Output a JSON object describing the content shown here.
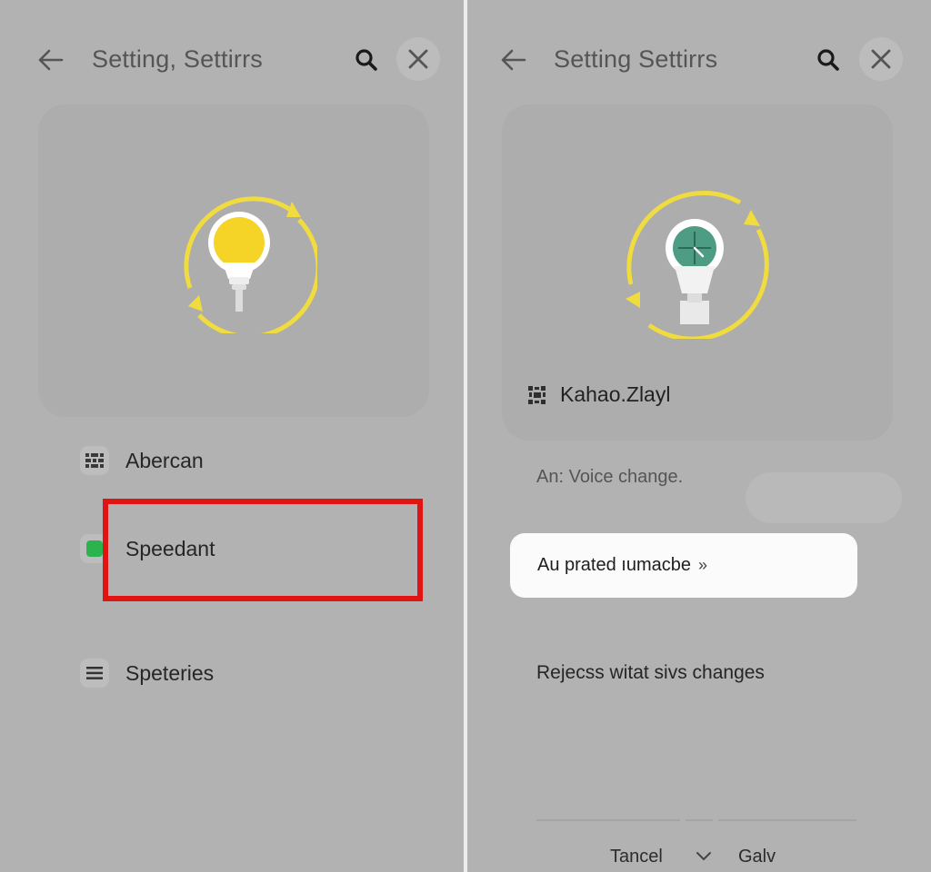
{
  "left_screen": {
    "header": {
      "title": "Setting, Settirrs",
      "back_icon": "arrow-left-icon",
      "search_icon": "search-icon",
      "close_icon": "close-icon"
    },
    "hero": {
      "icon": "lightbulb-refresh-icon",
      "bulb_color": "#f5d327",
      "ring_color": "#f1dc3f"
    },
    "menu": [
      {
        "label": "Abercan",
        "icon": "grid-icon"
      },
      {
        "label": "Speedant",
        "icon": "green-toggle-icon",
        "highlighted": true
      },
      {
        "label": "Speteries",
        "icon": "list-icon"
      }
    ],
    "highlight_color": "#e11414"
  },
  "right_screen": {
    "header": {
      "title": "Setting Settirrs",
      "back_icon": "arrow-left-icon",
      "search_icon": "search-icon",
      "close_icon": "close-icon"
    },
    "hero": {
      "icon": "lightbulb-clock-icon",
      "ring_color": "#f1dc3f",
      "clock_color": "#4e9c83"
    },
    "device": {
      "name": "Kahao.Zlayl",
      "icon": "device-icon"
    },
    "subtext": "An: Voice change.",
    "primary_button": {
      "label": "Au prated ıumacbe",
      "chevron": "»"
    },
    "reject_text": "Rejecss witat sivs changes",
    "footer": {
      "cancel_label": "Tancel",
      "chevron": "✓",
      "save_label": "Galv"
    }
  }
}
